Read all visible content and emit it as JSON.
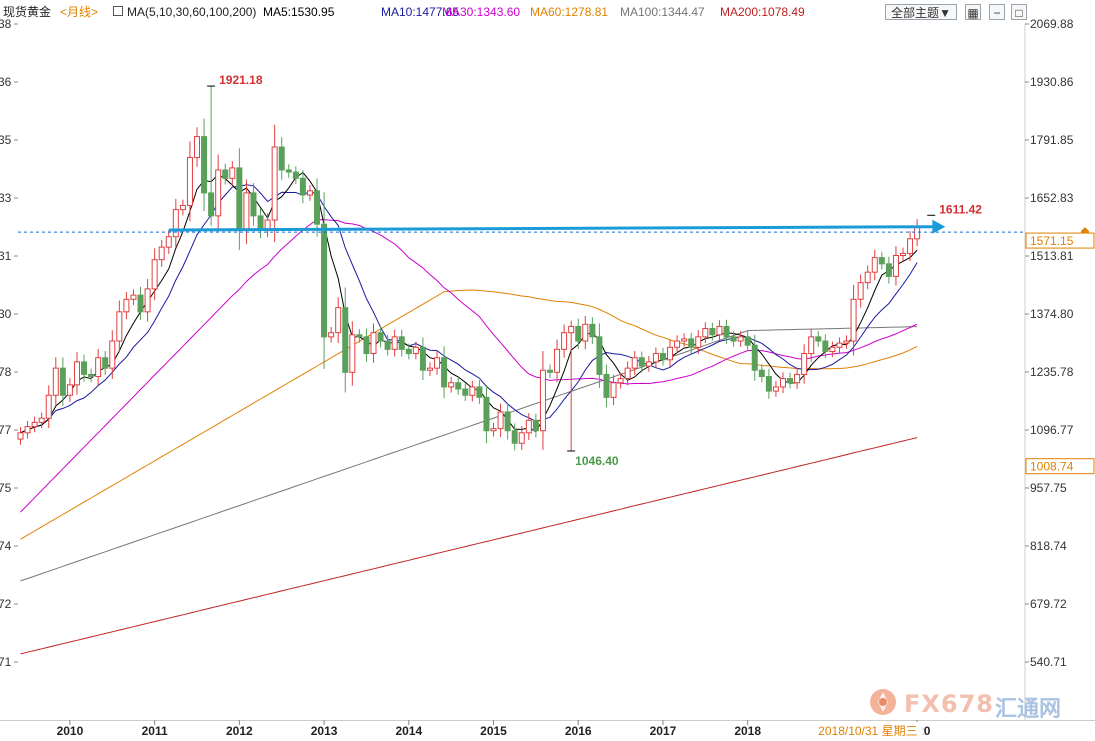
{
  "header": {
    "instrument": "现货黄金",
    "period": "<月线>",
    "ma_params": "MA(5,10,30,60,100,200)",
    "ma_values": [
      {
        "label": "MA5:1530.95",
        "color": "#000000"
      },
      {
        "label": "MA10:1477.65",
        "color": "#1a1aa0"
      },
      {
        "label": "MA30:1343.60",
        "color": "#cc00cc"
      },
      {
        "label": "MA60:1278.81",
        "color": "#e08000"
      },
      {
        "label": "MA100:1344.47",
        "color": "#777777"
      },
      {
        "label": "MA200:1078.49",
        "color": "#c02020"
      }
    ],
    "theme_select": "全部主题",
    "controls": [
      "grid-icon",
      "minus-icon",
      "restore-icon"
    ]
  },
  "colors": {
    "up": "#e04040",
    "down": "#5aa05a",
    "ma5": "#000000",
    "ma10": "#1a1aa0",
    "ma30": "#cc00cc",
    "ma60": "#e08000",
    "ma100": "#777777",
    "ma200": "#c02020",
    "resistance": "#1a9ad6",
    "hline": "#1a6ad0"
  },
  "chart_data": {
    "type": "candlestick",
    "y_ticks": [
      "2069.88",
      "1930.86",
      "1791.85",
      "1652.83",
      "1513.81",
      "1374.80",
      "1235.78",
      "1096.77",
      "957.75",
      "818.74",
      "679.72",
      "540.71"
    ],
    "y_tick_values": [
      2069.88,
      1930.86,
      1791.85,
      1652.83,
      1513.81,
      1374.8,
      1235.78,
      1096.77,
      957.75,
      818.74,
      679.72,
      540.71
    ],
    "left_tick_fragments": [
      "38",
      "36",
      "35",
      "33",
      "31",
      "30",
      "78",
      "77",
      "75",
      "74",
      "72",
      "71"
    ],
    "ylim": [
      450,
      2095
    ],
    "x_labels": [
      "2010",
      "2011",
      "2012",
      "2013",
      "2014",
      "2015",
      "2016",
      "2017",
      "2018",
      "2020"
    ],
    "x_label_months": [
      7,
      19,
      31,
      43,
      55,
      67,
      79,
      91,
      103,
      127
    ],
    "cursor_date_label": "2018/10/31 星期三",
    "cursor_month": 123,
    "price_marker": "1571.15",
    "price_marker_value": 1571.15,
    "cursor_price_label": "1008.74",
    "cursor_price_value": 1008.74,
    "annotations": [
      {
        "text": "1921.18",
        "month": 27,
        "value": 1921.18,
        "type": "high"
      },
      {
        "text": "1046.40",
        "month": 78,
        "value": 1046.4,
        "type": "low"
      },
      {
        "text": "1611.42",
        "month": 129,
        "value": 1611.42,
        "type": "high"
      }
    ],
    "resistance_line": {
      "start_month": 21,
      "end_month": 131,
      "start_value": 1576,
      "end_value": 1584
    },
    "horizontal_line": {
      "value": 1571.15
    },
    "closes": [
      1090,
      1105,
      1115,
      1125,
      1180,
      1245,
      1180,
      1205,
      1260,
      1230,
      1225,
      1270,
      1245,
      1310,
      1380,
      1410,
      1420,
      1380,
      1435,
      1505,
      1535,
      1560,
      1625,
      1635,
      1750,
      1800,
      1665,
      1610,
      1720,
      1700,
      1725,
      1575,
      1665,
      1610,
      1575,
      1600,
      1775,
      1720,
      1715,
      1700,
      1660,
      1670,
      1590,
      1320,
      1330,
      1390,
      1235,
      1325,
      1320,
      1280,
      1330,
      1310,
      1290,
      1320,
      1290,
      1280,
      1295,
      1240,
      1245,
      1270,
      1200,
      1210,
      1195,
      1180,
      1200,
      1175,
      1095,
      1100,
      1140,
      1095,
      1065,
      1090,
      1120,
      1095,
      1240,
      1235,
      1290,
      1330,
      1345,
      1310,
      1350,
      1320,
      1230,
      1175,
      1210,
      1220,
      1245,
      1270,
      1250,
      1260,
      1280,
      1265,
      1295,
      1310,
      1315,
      1295,
      1320,
      1340,
      1325,
      1345,
      1320,
      1310,
      1320,
      1300,
      1240,
      1225,
      1190,
      1200,
      1220,
      1210,
      1230,
      1280,
      1320,
      1310,
      1285,
      1295,
      1305,
      1310,
      1410,
      1450,
      1475,
      1510,
      1495,
      1465,
      1515,
      1520,
      1555,
      1585
    ],
    "series": [
      {
        "name": "MA5",
        "value": 1530.95
      },
      {
        "name": "MA10",
        "value": 1477.65
      },
      {
        "name": "MA30",
        "value": 1343.6
      },
      {
        "name": "MA60",
        "value": 1278.81
      },
      {
        "name": "MA100",
        "value": 1344.47
      },
      {
        "name": "MA200",
        "value": 1078.49
      }
    ],
    "grid": false,
    "legend_position": "top"
  },
  "watermark": {
    "brand": "FX678",
    "suffix": "汇通网"
  }
}
